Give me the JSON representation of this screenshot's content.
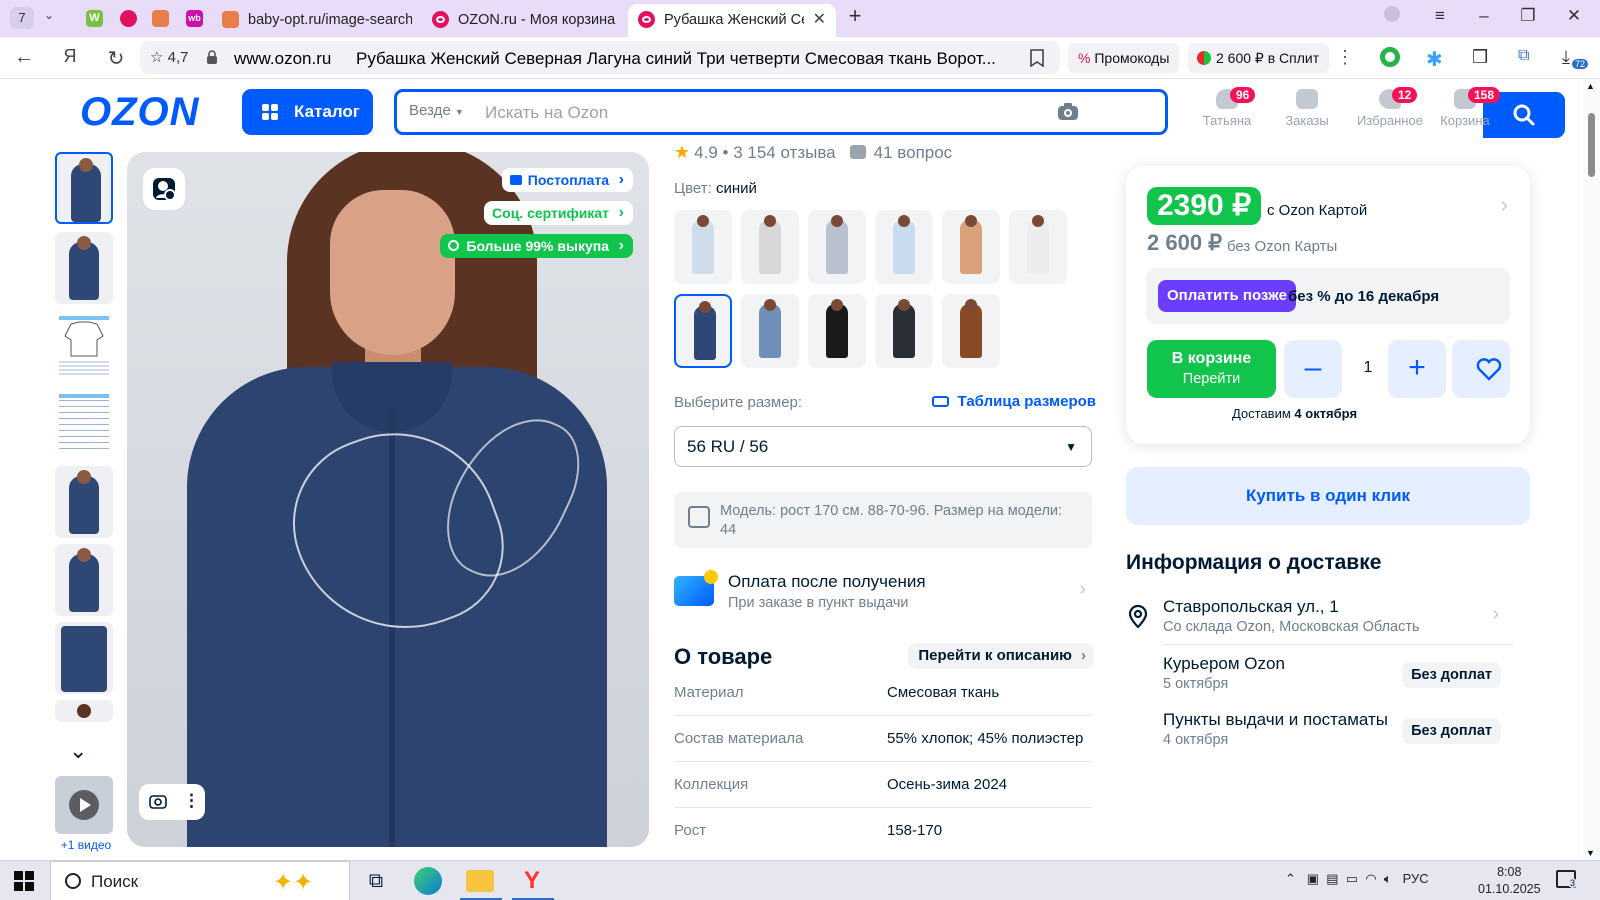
{
  "browser": {
    "tab_count": "7",
    "tabs": [
      {
        "title": "baby-opt.ru/image-search"
      },
      {
        "title": "OZON.ru - Моя корзина"
      },
      {
        "title": "Рубашка Женский Северная Лагуна"
      }
    ],
    "pinned_tabs": [
      {
        "icon": "w-icon",
        "letter": "W",
        "color": "#7bc043"
      },
      {
        "icon": "ozon-icon",
        "letter": "",
        "color": "#e0115f"
      },
      {
        "icon": "gift-icon",
        "letter": "",
        "color": "#e57e48"
      },
      {
        "icon": "wb-icon",
        "letter": "wb",
        "color": "#cb11ab"
      }
    ],
    "site_rating": "4,7",
    "url_domain": "www.ozon.ru",
    "page_title": "Рубашка Женский Северная Лагуна синий Три четверти Смесовая ткань Ворот...",
    "promo_label": "Промокоды",
    "split_label": "2 600 ₽ в Сплит",
    "ext_badge": "72"
  },
  "header": {
    "logo": "OZON",
    "catalog_label": "Каталог",
    "search_scope": "Везде",
    "search_placeholder": "Искать на Ozon",
    "items": [
      {
        "label": "Татьяна",
        "badge": "96"
      },
      {
        "label": "Заказы",
        "badge": ""
      },
      {
        "label": "Избранное",
        "badge": "12"
      },
      {
        "label": "Корзина",
        "badge": "158"
      }
    ]
  },
  "gallery": {
    "badges": {
      "postpay": "Постоплата",
      "soc": "Соц. сертификат",
      "buyout": "Больше 99% выкупа"
    },
    "video_link": "+1 видео"
  },
  "product": {
    "rating": "4.9",
    "reviews": "3 154 отзыва",
    "questions": "41 вопрос",
    "color_label": "Цвет:",
    "color_value": "синий",
    "swatches": [
      {
        "color": "#cfdcea"
      },
      {
        "color": "#d8d8d8"
      },
      {
        "color": "#b9c1cf"
      },
      {
        "color": "#c9dbef"
      },
      {
        "color": "#d9a07a"
      },
      {
        "color": "#ececec"
      },
      {
        "color": "#2f4775"
      },
      {
        "color": "#6f8fb8"
      },
      {
        "color": "#1a1a1a"
      },
      {
        "color": "#2a2f36"
      },
      {
        "color": "#8a4a26"
      }
    ],
    "size_label": "Выберите размер:",
    "size_table": "Таблица размеров",
    "size_selected": "56 RU / 56",
    "model_info": "Модель: рост 170 см. 88-70-96. Размер на модели: 44",
    "pay_after_title": "Оплата после получения",
    "pay_after_sub": "При заказе в пункт выдачи",
    "about_title": "О товаре",
    "to_description": "Перейти к описанию",
    "specs": [
      {
        "key": "Материал",
        "value": "Смесовая ткань"
      },
      {
        "key": "Состав материала",
        "value": "55% хлопок; 45% полиэстер"
      },
      {
        "key": "Коллекция",
        "value": "Осень-зима 2024"
      },
      {
        "key": "Рост",
        "value": "158-170"
      }
    ]
  },
  "buy": {
    "price_card": "2390 ₽",
    "price_card_label": "с Ozon Картой",
    "price_regular": "2 600 ₽",
    "price_regular_label": "без Ozon Карты",
    "pay_later_btn": "Оплатить позже",
    "pay_later_text": "без % до 16 декабря",
    "cart_btn_title": "В корзине",
    "cart_btn_sub": "Перейти",
    "quantity": "1",
    "deliver_prefix": "Доставим",
    "deliver_date": "4 октября",
    "one_click": "Купить в один клик"
  },
  "delivery": {
    "title": "Информация о доставке",
    "items": [
      {
        "title": "Ставропольская ул., 1",
        "sub": "Со склада Ozon, Московская Область",
        "tag": ""
      },
      {
        "title": "Курьером Ozon",
        "sub": "5 октября",
        "tag": "Без доплат"
      },
      {
        "title": "Пункты выдачи и постаматы",
        "sub": "4 октября",
        "tag": "Без доплат"
      }
    ]
  },
  "taskbar": {
    "search_label": "Поиск",
    "lang": "РУС",
    "time": "8:08",
    "date": "01.10.2025",
    "notif_count": "3"
  },
  "colors": {
    "brand": "#005bff",
    "price_green": "#10c44c",
    "badge_pink": "#f91155",
    "pay_later": "#6b3eff"
  }
}
